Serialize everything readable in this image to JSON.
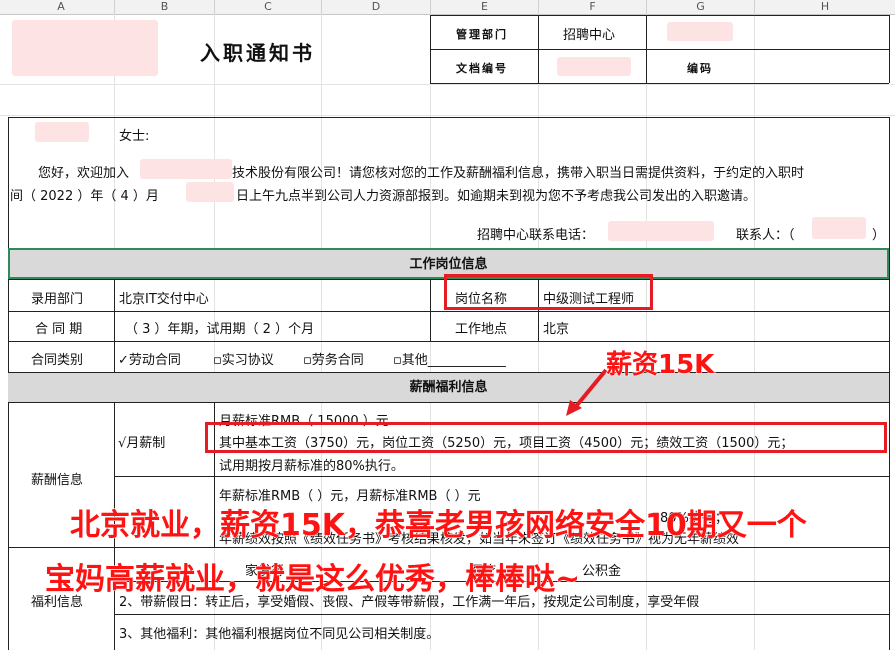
{
  "columns": [
    "A",
    "B",
    "C",
    "D",
    "E",
    "F",
    "G",
    "H"
  ],
  "header": {
    "title": "入职通知书",
    "dept_label": "管理部门",
    "dept_value": "招聘中心",
    "doc_label": "文档编号",
    "code_label": "编码"
  },
  "greeting": {
    "salutation": "女士:",
    "line1_a": "您好，欢迎加入",
    "line1_b": "技术股份有限公司！请您核对您的工作及薪酬福利信息，携带入职当日需提供资料，于约定的入职时",
    "line2_a": "间（ 2022 ）年（ 4 ）月",
    "line2_b": "日上午九点半到公司人力资源部报到。如逾期未到视为您不予考虑我公司发出的入职邀请。",
    "phone_label": "招聘中心联系电话：",
    "contact_label": "联系人：（",
    "contact_close": "）"
  },
  "job_section": {
    "title": "工作岗位信息",
    "dept_label": "录用部门",
    "dept_value": "北京IT交付中心",
    "position_label": "岗位名称",
    "position_value": "中级测试工程师",
    "contract_label": "合 同 期",
    "contract_value": "（ 3 ）年期，试用期（ 2 ）个月",
    "location_label": "工作地点",
    "location_value": "北京",
    "type_label": "合同类别",
    "type_opt1": "✓劳动合同",
    "type_opt2": "▫实习协议",
    "type_opt3": "▫劳务合同",
    "type_opt4": "▫其他____________"
  },
  "salary_section": {
    "title": "薪酬福利信息",
    "salary_label": "薪酬信息",
    "monthly_label": "√月薪制",
    "monthly_line1": "月薪标准RMB（  15000  ）元",
    "monthly_line2": "其中基本工资（3750）元，岗位工资（5250）元，项目工资（4500）元；绩效工资（1500）元；",
    "monthly_line3": "试用期按月薪标准的80%执行。",
    "annual_line1": "年薪标准RMB（    ）元，月薪标准RMB（    ）元",
    "annual_line2": "80%执行；",
    "annual_line3": "年薪绩效按照《绩效任务书》考核结果核发，如当年未签订《绩效任务书》视为无年薪绩效",
    "benefit_label": "福利信息",
    "benefit1_a": "家发行",
    "benefit1_b": "医疗",
    "benefit1_c": "公积金",
    "benefit2": "2、带薪假日：转正后，享受婚假、丧假、产假等带薪假，工作满一年后，按规定公司制度，享受年假",
    "benefit3": "3、其他福利：其他福利根据岗位不同见公司相关制度。"
  },
  "overlays": {
    "salary_callout": "薪资15K",
    "caption_line1": "北京就业，薪资15K，恭喜老男孩网络安全10期又一个",
    "caption_line2": "宝妈高薪就业，就是这么优秀，棒棒哒~"
  },
  "colors": {
    "accent_red": "#e51c23",
    "section_gray": "#d9d9d9",
    "redacted_pink": "#fde3e3"
  }
}
